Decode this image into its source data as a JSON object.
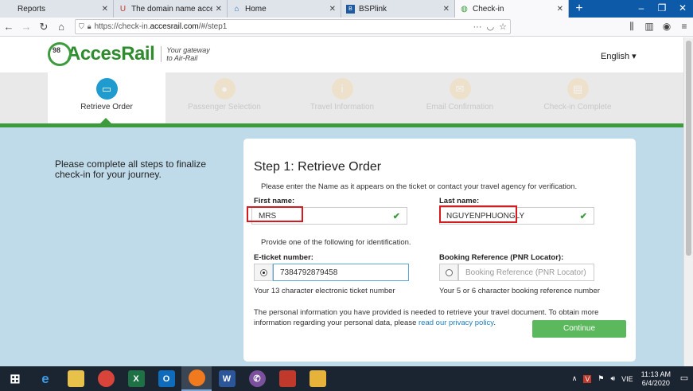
{
  "browser": {
    "tabs": [
      {
        "label": "Reports",
        "active": false,
        "icon": "blank-page-icon"
      },
      {
        "label": "The domain name accessrail.co",
        "active": false,
        "icon": "magnet-icon"
      },
      {
        "label": "Home",
        "active": false,
        "icon": "home-icon"
      },
      {
        "label": "BSPlink",
        "active": false,
        "icon": "bsp-icon"
      },
      {
        "label": "Check-in",
        "active": true,
        "icon": "globe-icon"
      }
    ],
    "url_prefix": "https://check-in.",
    "url_domain": "accesrail.com",
    "url_suffix": "/#/step1"
  },
  "site": {
    "logo_number": "98",
    "logo_name": "AccesRail",
    "tagline_line1": "Your gateway",
    "tagline_line2": "to Air-Rail",
    "language": "English"
  },
  "steps": [
    {
      "label": "Retrieve Order",
      "active": true
    },
    {
      "label": "Passenger Selection",
      "active": false
    },
    {
      "label": "Travel Information",
      "active": false
    },
    {
      "label": "Email Confirmation",
      "active": false
    },
    {
      "label": "Check-in Complete",
      "active": false
    }
  ],
  "intro": "Please complete all steps to finalize check-in for your journey.",
  "form": {
    "title": "Step 1: Retrieve Order",
    "instruction": "Please enter the Name as it appears on the ticket or contact your travel agency for verification.",
    "first_name_label": "First name:",
    "first_name_value": "MRS",
    "last_name_label": "Last name:",
    "last_name_value": "NGUYENPHUONGLY",
    "identification_text": "Provide one of the following for identification.",
    "eticket_label": "E-ticket number:",
    "eticket_value": "7384792879458",
    "eticket_hint": "Your 13 character electronic ticket number",
    "pnr_label": "Booking Reference (PNR Locator):",
    "pnr_placeholder": "Booking Reference (PNR Locator)",
    "pnr_hint": "Your 5 or 6 character booking reference number",
    "privacy_text": "The personal information you have provided is needed to retrieve your travel document. To obtain more information regarding your personal data, please ",
    "privacy_link": "read our privacy policy",
    "privacy_end": ".",
    "continue_label": "Continue"
  },
  "taskbar": {
    "lang": "VIE",
    "time": "11:13 AM",
    "date": "6/4/2020"
  }
}
